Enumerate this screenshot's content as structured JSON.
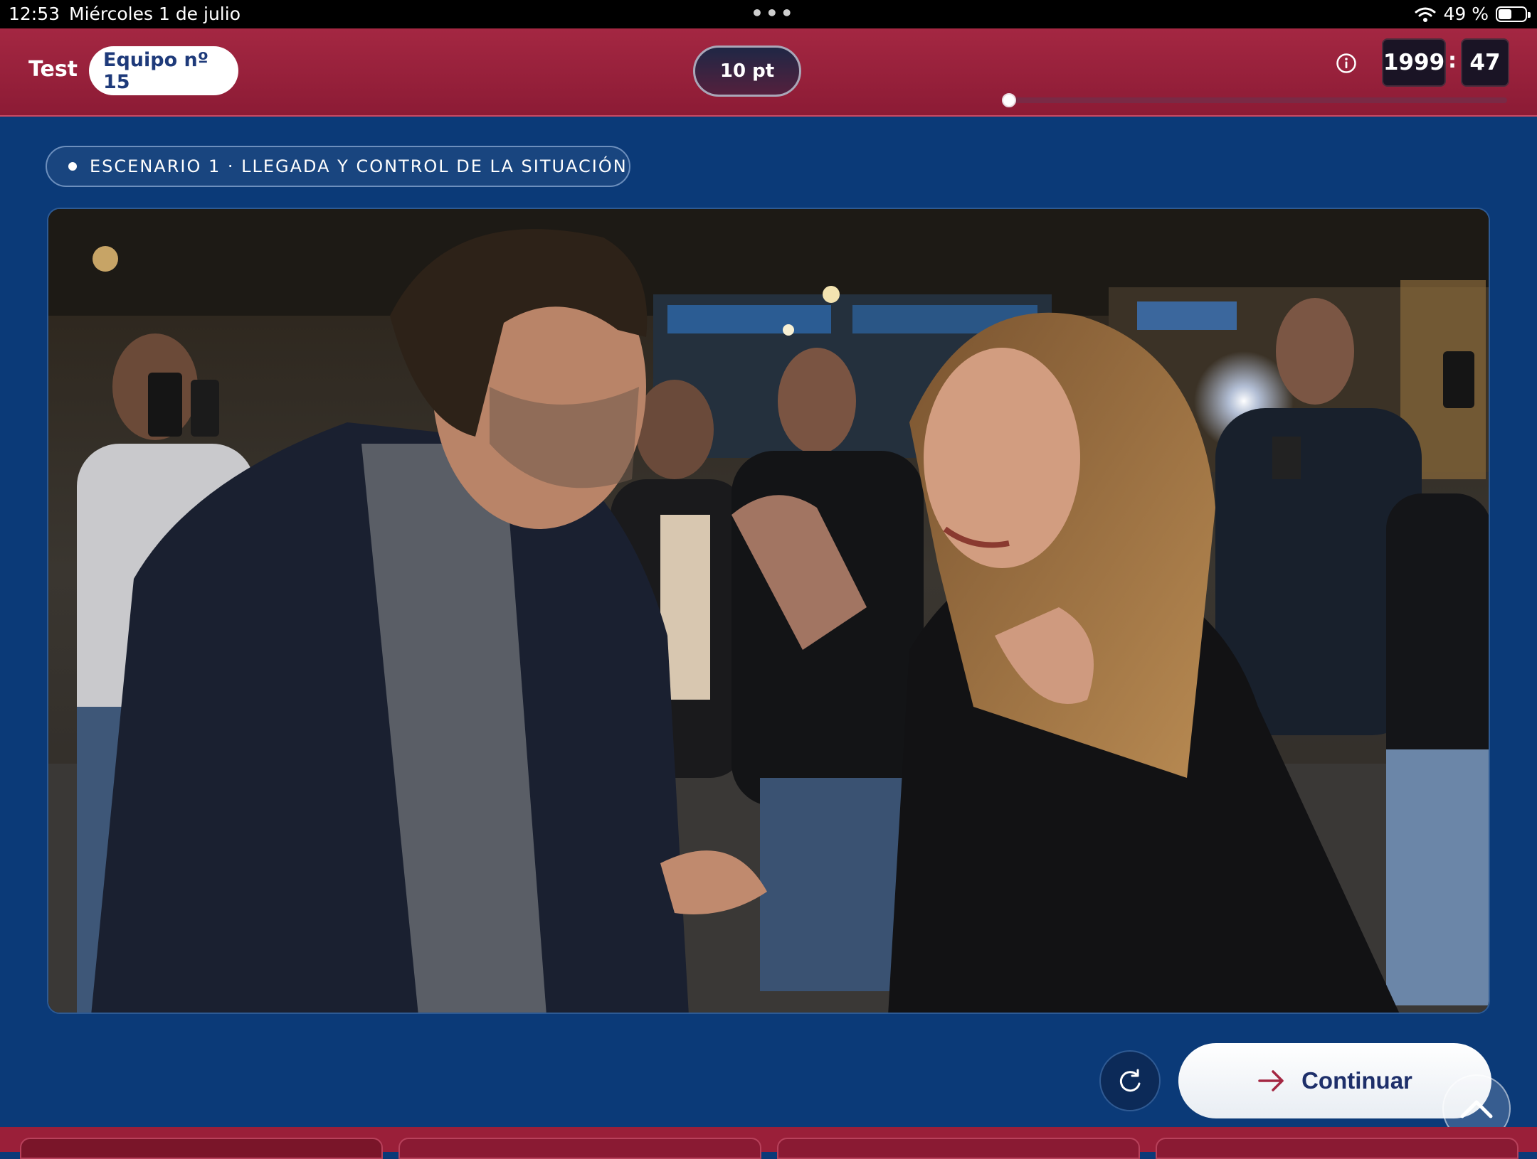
{
  "status_bar": {
    "time": "12:53",
    "date": "Miércoles 1 de julio",
    "battery_text": "49 %",
    "battery_level": 0.49,
    "icons": [
      "wifi-icon",
      "battery-icon"
    ]
  },
  "header": {
    "brand": "Test",
    "team": "Equipo nº 15",
    "points": "10 pt",
    "timer_minutes": "1999",
    "timer_seconds": "47",
    "timer_separator": ":",
    "progress_fraction": 0.0,
    "icons": [
      "info-icon"
    ]
  },
  "scenario": {
    "label": "ESCENARIO 1 · LLEGADA Y CONTROL DE LA SITUACIÓN"
  },
  "scene_image": {
    "subject": "night street argument between a man and a woman with onlookers filming"
  },
  "actions": {
    "continue_label": "Continuar",
    "icons": [
      "refresh-icon",
      "arrow-right-icon",
      "chevron-up-icon"
    ]
  },
  "colors": {
    "header_red": "#9a1f39",
    "background_blue": "#0b3a78",
    "button_text": "#1e2f6a",
    "arrow_red": "#a42742"
  }
}
